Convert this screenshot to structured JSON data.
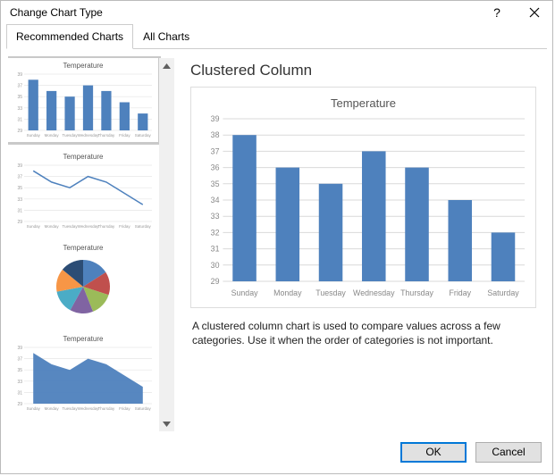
{
  "window": {
    "title": "Change Chart Type"
  },
  "tabs": {
    "recommended": "Recommended Charts",
    "all": "All Charts"
  },
  "sidebar": {
    "thumb_title": "Temperature"
  },
  "main": {
    "chart_type_title": "Clustered Column",
    "chart_title": "Temperature",
    "description_line1": "A clustered column chart is used to compare values across a few",
    "description_line2": "categories. Use it when the order of categories is not important."
  },
  "buttons": {
    "ok": "OK",
    "cancel": "Cancel"
  },
  "colors": {
    "bar": "#4e81bd",
    "grid": "#d9d9d9",
    "axis_text": "#888"
  },
  "chart_data": {
    "type": "bar",
    "title": "Temperature",
    "categories": [
      "Sunday",
      "Monday",
      "Tuesday",
      "Wednesday",
      "Thursday",
      "Friday",
      "Saturday"
    ],
    "values": [
      38,
      36,
      35,
      37,
      36,
      34,
      32
    ],
    "ylabel": "",
    "xlabel": "",
    "ylim": [
      29,
      39
    ],
    "yticks": [
      29,
      30,
      31,
      32,
      33,
      34,
      35,
      36,
      37,
      38,
      39
    ]
  },
  "thumbnail_charts": [
    {
      "type": "bar"
    },
    {
      "type": "line"
    },
    {
      "type": "pie",
      "slices": [
        16,
        14,
        14,
        14,
        14,
        14,
        14
      ],
      "colors": [
        "#4e81bd",
        "#c0504d",
        "#9bbb59",
        "#8064a2",
        "#4bacc6",
        "#f79646",
        "#2c4d75"
      ]
    },
    {
      "type": "area"
    }
  ]
}
